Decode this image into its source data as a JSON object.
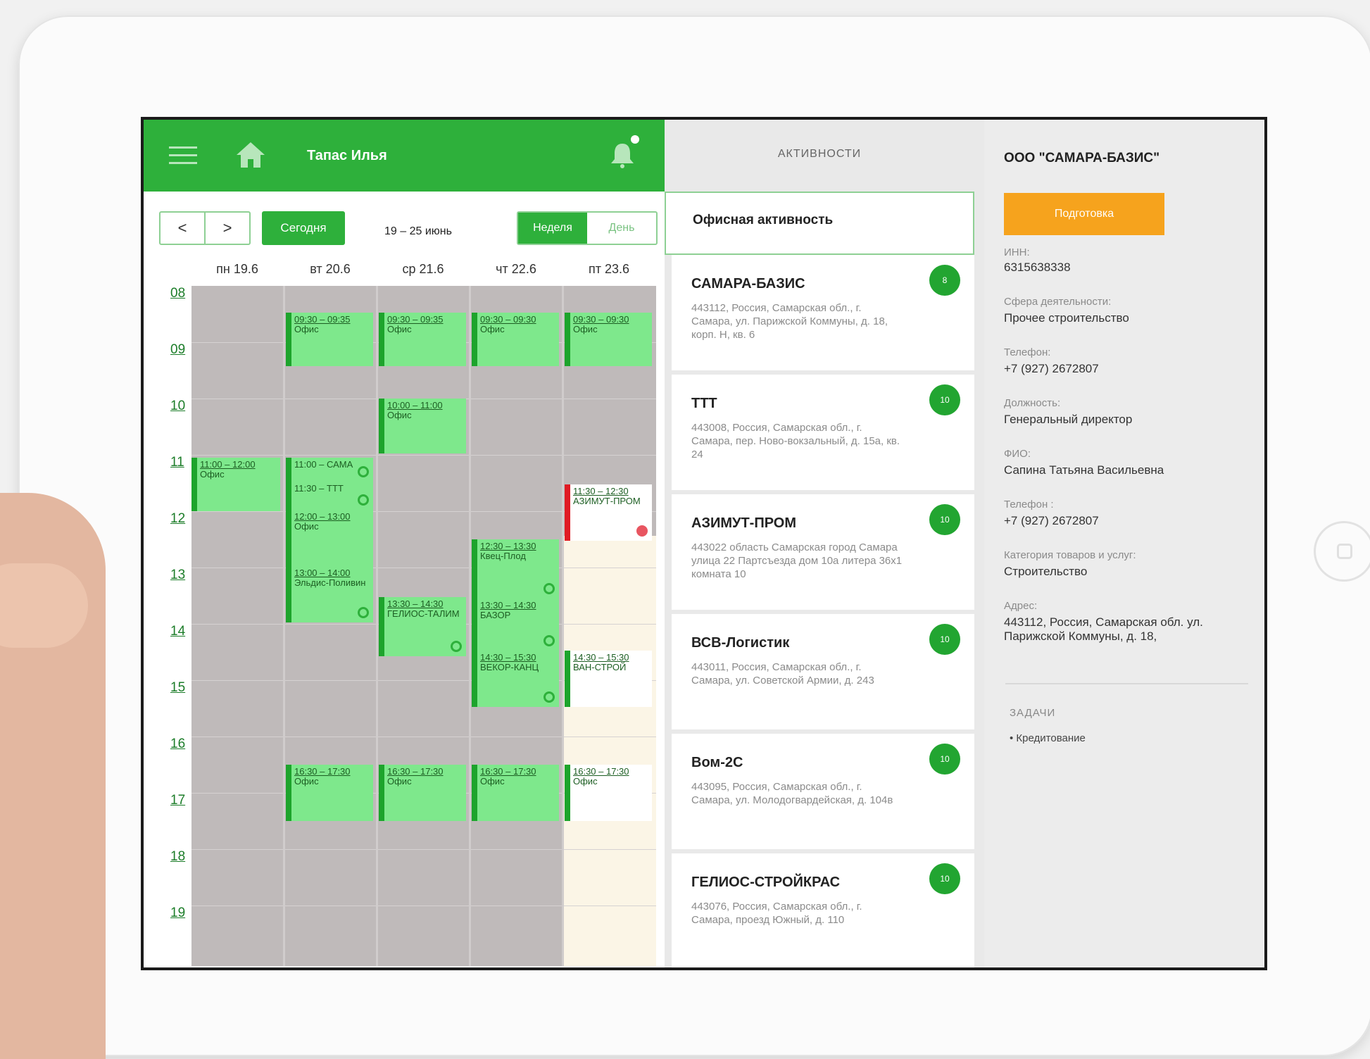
{
  "header": {
    "user_name": "Тапас Илья"
  },
  "toolbar": {
    "prev": "<",
    "next": ">",
    "today": "Сегодня",
    "range": "19 – 25 июнь",
    "view_week": "Неделя",
    "view_day": "День"
  },
  "days": [
    "пн 19.6",
    "вт 20.6",
    "ср 21.6",
    "чт 22.6",
    "пт 23.6"
  ],
  "hours": [
    "08",
    "09",
    "10",
    "11",
    "12",
    "13",
    "14",
    "15",
    "16",
    "17",
    "18",
    "19"
  ],
  "events": [
    {
      "time": "09:30 – 09:35",
      "title": "Офис"
    },
    {
      "time": "09:30 – 09:35",
      "title": "Офис"
    },
    {
      "time": "09:30 – 09:30",
      "title": "Офис"
    },
    {
      "time": "09:30 – 09:30",
      "title": "Офис"
    },
    {
      "time": "10:00 – 11:00",
      "title": "Офис"
    },
    {
      "time": "11:00 – 12:00",
      "title": "Офис"
    },
    {
      "time": "11:00 – САМА",
      "title": ""
    },
    {
      "time": "11:30 – ТТТ",
      "title": ""
    },
    {
      "time": "12:00 – 13:00",
      "title": "Офис"
    },
    {
      "time": "13:00 – 14:00",
      "title": "Эльдис-Поливин"
    },
    {
      "time": "11:30 – 12:30",
      "title": "АЗИМУТ-ПРОМ"
    },
    {
      "time": "12:30 – 13:30",
      "title": "Квец-Плод"
    },
    {
      "time": "13:30 – 14:30",
      "title": "ГЕЛИОС-ТАЛИМ"
    },
    {
      "time": "13:30 – 14:30",
      "title": "БАЗОР"
    },
    {
      "time": "14:30 – 15:30",
      "title": "ВЕКОР-КАНЦ"
    },
    {
      "time": "14:30 – 15:30",
      "title": "ВАН-СТРОЙ"
    },
    {
      "time": "16:30 – 17:30",
      "title": "Офис"
    },
    {
      "time": "16:30 – 17:30",
      "title": "Офис"
    },
    {
      "time": "16:30 – 17:30",
      "title": "Офис"
    },
    {
      "time": "16:30 – 17:30",
      "title": "Офис"
    }
  ],
  "activities": {
    "title": "АКТИВНОСТИ",
    "selected": "Офисная активность",
    "items": [
      {
        "name": "САМАРА-БАЗИС",
        "address": "443112, Россия, Самарская обл., г. Самара, ул. Парижской Коммуны, д. 18, корп. Н, кв. 6",
        "badge": "8"
      },
      {
        "name": "ТТТ",
        "address": "443008, Россия, Самарская обл., г. Самара, пер. Ново-вокзальный, д. 15а, кв. 24",
        "badge": "10"
      },
      {
        "name": "АЗИМУТ-ПРОМ",
        "address": "443022 область Самарская город Самара улица 22 Партсъезда дом 10а литера 36х1 комната 10",
        "badge": "10"
      },
      {
        "name": "ВСВ-Логистик",
        "address": "443011, Россия, Самарская обл., г. Самара, ул. Советской Армии, д. 243",
        "badge": "10"
      },
      {
        "name": "Вом-2С",
        "address": "443095, Россия, Самарская обл., г. Самара, ул. Молодогвардейская, д. 104в",
        "badge": "10"
      },
      {
        "name": "ГЕЛИОС-СТРОЙКРАС",
        "address": "443076, Россия, Самарская обл., г. Самара, проезд Южный, д. 110",
        "badge": "10"
      }
    ]
  },
  "details": {
    "org": "ООО \"САМАРА-БАЗИС\"",
    "button": "Подготовка",
    "fields": [
      {
        "label": "ИНН:",
        "value": "6315638338"
      },
      {
        "label": "Сфера деятельности:",
        "value": "Прочее строительство"
      },
      {
        "label": "Телефон:",
        "value": "+7 (927) 2672807"
      },
      {
        "label": "Должность:",
        "value": "Генеральный директор"
      },
      {
        "label": "ФИО:",
        "value": "Сапина Татьяна Васильевна"
      },
      {
        "label": "Телефон :",
        "value": "+7 (927) 2672807"
      },
      {
        "label": "Категория товаров и услуг:",
        "value": "Строительство"
      },
      {
        "label": "Адрес:",
        "value": "443112, Россия, Самарская обл. ул. Парижской Коммуны, д. 18,"
      }
    ],
    "tasks_title": "ЗАДАЧИ",
    "tasks": [
      "Кредитование"
    ]
  },
  "colors": {
    "green": "#2eb03b",
    "event": "#7ee88c",
    "orange": "#f6a31d",
    "grid": "#bfbaba"
  }
}
